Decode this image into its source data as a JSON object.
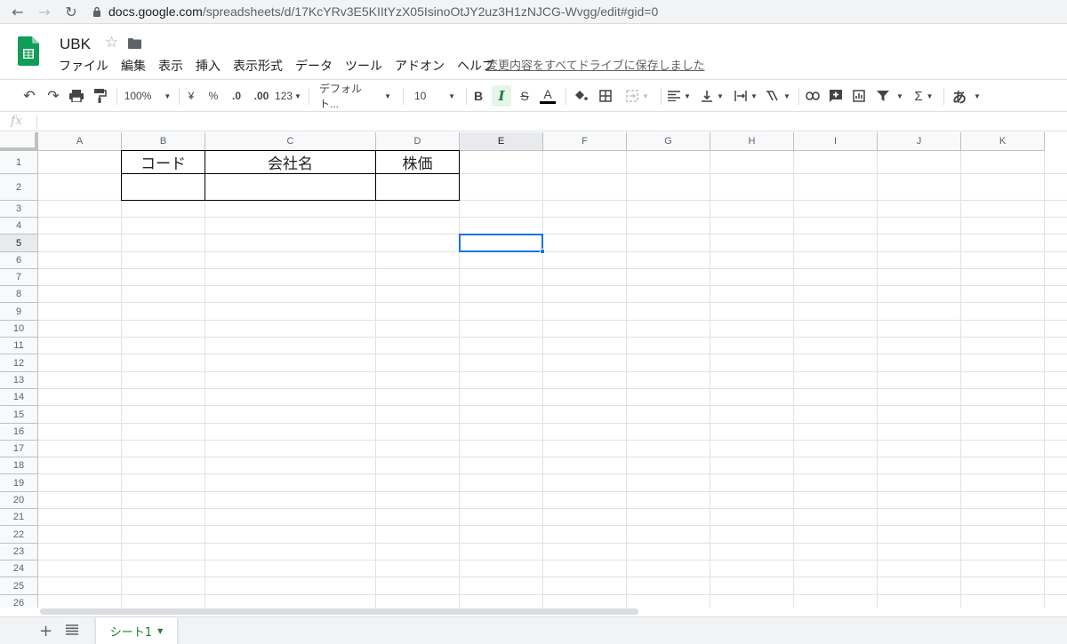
{
  "browser": {
    "url_host": "docs.google.com",
    "url_path": "/spreadsheets/d/17KcYRv3E5KIItYzX05IsinoOtJY2uz3H1zNJCG-Wvgg/edit#gid=0"
  },
  "header": {
    "title": "UBK",
    "saved_status": "変更内容をすべてドライブに保存しました"
  },
  "menu": {
    "items": [
      "ファイル",
      "編集",
      "表示",
      "挿入",
      "表示形式",
      "データ",
      "ツール",
      "アドオン",
      "ヘルプ"
    ]
  },
  "toolbar": {
    "zoom": "100%",
    "currency": "¥",
    "percent": "%",
    "decrease_decimal": ".0",
    "increase_decimal": ".00",
    "more_formats": "123",
    "font": "デフォルト...",
    "font_size": "10",
    "bold": "B",
    "italic": "I",
    "strike": "S",
    "text_color": "A",
    "functions": "Σ",
    "input_tools": "あ"
  },
  "formula_bar": {
    "fx": "fx",
    "value": ""
  },
  "columns": [
    "A",
    "B",
    "C",
    "D",
    "E",
    "F",
    "G",
    "H",
    "I",
    "J",
    "K"
  ],
  "rows": [
    "1",
    "2",
    "3",
    "4",
    "5",
    "6",
    "7",
    "8",
    "9",
    "10",
    "11",
    "12",
    "13",
    "14",
    "15",
    "16",
    "17",
    "18",
    "19",
    "20",
    "21",
    "22",
    "23",
    "24",
    "25",
    "26"
  ],
  "cells": {
    "B1": "コード",
    "C1": "会社名",
    "D1": "株価",
    "B2": "",
    "C2": "",
    "D2": ""
  },
  "selection": {
    "cell": "E5",
    "column": "E",
    "row": "5"
  },
  "sheets": [
    {
      "name": "シート1",
      "active": true
    }
  ],
  "colors": {
    "accent": "#1a73e8",
    "sheets_green": "#188038"
  }
}
